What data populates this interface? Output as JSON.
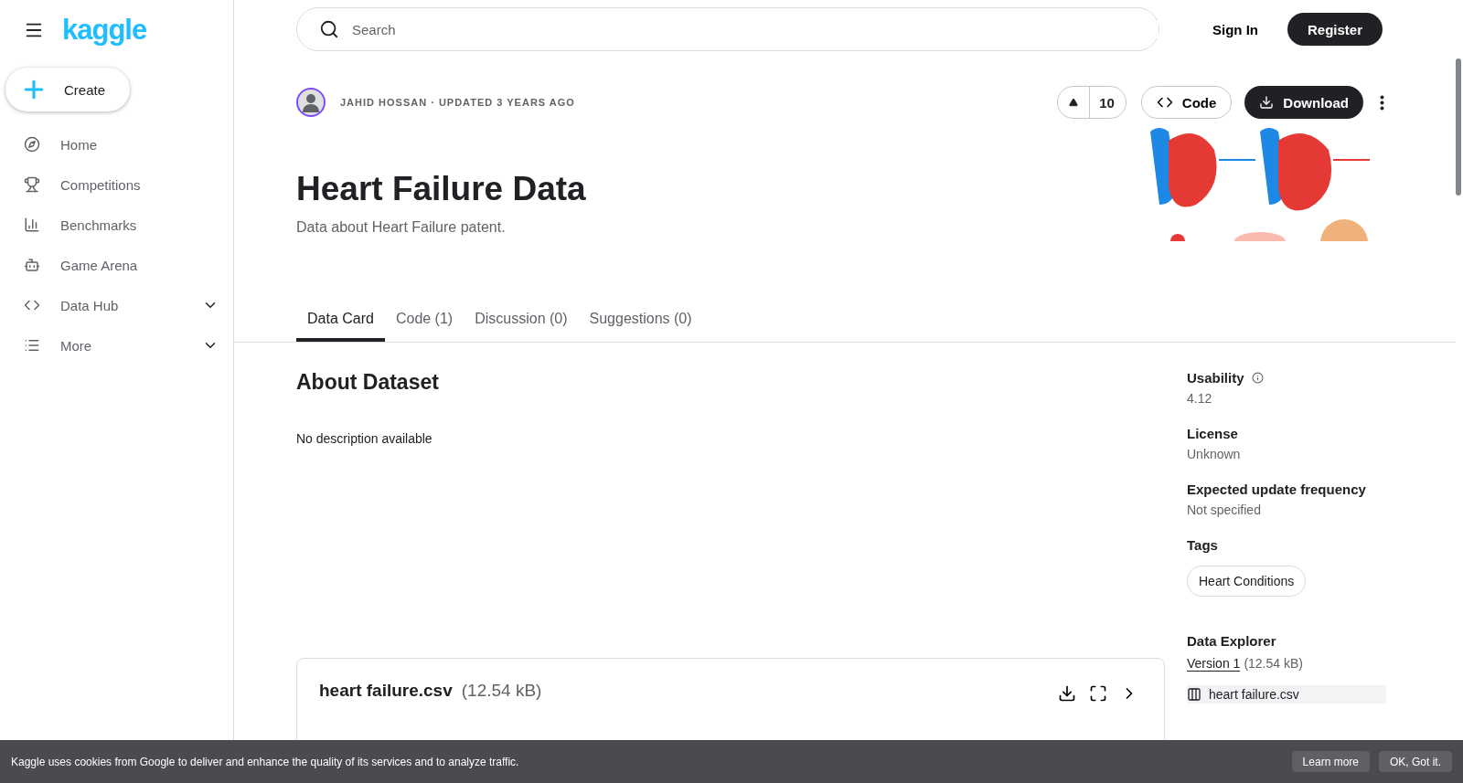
{
  "brand": {
    "logo": "kaggle"
  },
  "create_button": {
    "label": "Create"
  },
  "sidebar": {
    "items": [
      {
        "label": "Home",
        "expandable": false
      },
      {
        "label": "Competitions",
        "expandable": false
      },
      {
        "label": "Benchmarks",
        "expandable": false
      },
      {
        "label": "Game Arena",
        "expandable": false
      },
      {
        "label": "Data Hub",
        "expandable": true
      },
      {
        "label": "More",
        "expandable": true
      }
    ]
  },
  "search": {
    "placeholder": "Search"
  },
  "auth": {
    "sign_in": "Sign In",
    "register": "Register"
  },
  "dataset": {
    "byline": "JAHID HOSSAN · UPDATED 3 YEARS AGO",
    "votes": "10",
    "code_button": "Code",
    "download_button": "Download",
    "title": "Heart Failure Data",
    "subtitle": "Data about Heart Failure patent."
  },
  "tabs": [
    {
      "label": "Data Card",
      "selected": true
    },
    {
      "label": "Code (1)",
      "selected": false
    },
    {
      "label": "Discussion (0)",
      "selected": false
    },
    {
      "label": "Suggestions (0)",
      "selected": false
    }
  ],
  "about": {
    "heading": "About Dataset",
    "description": "No description available"
  },
  "file_card": {
    "name": "heart failure.csv",
    "size": "(12.54 kB)"
  },
  "meta": [
    {
      "kind": "info",
      "label": "Usability",
      "value": "4.12"
    },
    {
      "kind": "text",
      "label": "License",
      "value": "Unknown"
    },
    {
      "kind": "text",
      "label": "Expected update frequency",
      "value": "Not specified"
    },
    {
      "kind": "tags",
      "label": "Tags",
      "tags": [
        "Heart Conditions"
      ]
    }
  ],
  "data_explorer": {
    "heading": "Data Explorer",
    "version_link": "Version 1",
    "version_size": "(12.54 kB)",
    "files": [
      "heart failure.csv"
    ]
  },
  "cookie_bar": {
    "message": "Kaggle uses cookies from Google to deliver and enhance the quality of its services and to analyze traffic.",
    "learn_more": "Learn more",
    "ok": "OK, Got it."
  }
}
